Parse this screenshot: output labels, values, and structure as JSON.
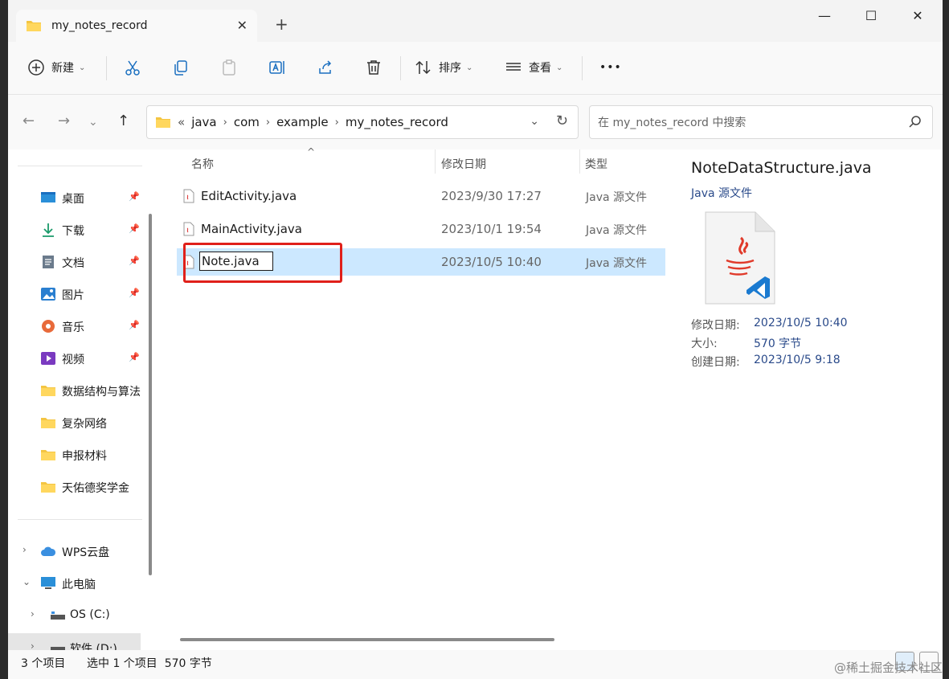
{
  "window": {
    "tab_title": "my_notes_record",
    "close_tab": "✕",
    "new_tab": "+",
    "minimize": "—",
    "maximize": "☐",
    "close": "✕"
  },
  "toolbar": {
    "new_label": "新建",
    "sort_label": "排序",
    "view_label": "查看",
    "more_label": "•••"
  },
  "address": {
    "prefix": "«",
    "crumbs": [
      "java",
      "com",
      "example",
      "my_notes_record"
    ]
  },
  "search": {
    "placeholder": "在 my_notes_record 中搜索"
  },
  "sidebar": {
    "quick": [
      {
        "label": "桌面",
        "icon": "desktop-icon"
      },
      {
        "label": "下载",
        "icon": "download-icon"
      },
      {
        "label": "文档",
        "icon": "document-icon"
      },
      {
        "label": "图片",
        "icon": "picture-icon"
      },
      {
        "label": "音乐",
        "icon": "music-icon"
      },
      {
        "label": "视频",
        "icon": "video-icon"
      },
      {
        "label": "数据结构与算法",
        "icon": "folder-icon"
      },
      {
        "label": "复杂网络",
        "icon": "folder-icon"
      },
      {
        "label": "申报材料",
        "icon": "folder-icon"
      },
      {
        "label": "天佑德奖学金",
        "icon": "folder-icon"
      }
    ],
    "wps": "WPS云盘",
    "pc": "此电脑",
    "drive_c": "OS (C:)",
    "drive_d": "软件 (D:)"
  },
  "columns": {
    "name": "名称",
    "date": "修改日期",
    "type": "类型"
  },
  "files": [
    {
      "name": "EditActivity.java",
      "date": "2023/9/30 17:27",
      "type": "Java 源文件"
    },
    {
      "name": "MainActivity.java",
      "date": "2023/10/1 19:54",
      "type": "Java 源文件"
    },
    {
      "name": "Note.java",
      "date": "2023/10/5 10:40",
      "type": "Java 源文件"
    }
  ],
  "preview": {
    "title": "NoteDataStructure.java",
    "type": "Java 源文件",
    "modified_label": "修改日期:",
    "modified": "2023/10/5 10:40",
    "size_label": "大小:",
    "size": "570 字节",
    "created_label": "创建日期:",
    "created": "2023/10/5 9:18"
  },
  "status": {
    "count": "3 个项目",
    "selected": "选中 1 个项目  570 字节"
  },
  "watermark": "@稀土掘金技术社区"
}
